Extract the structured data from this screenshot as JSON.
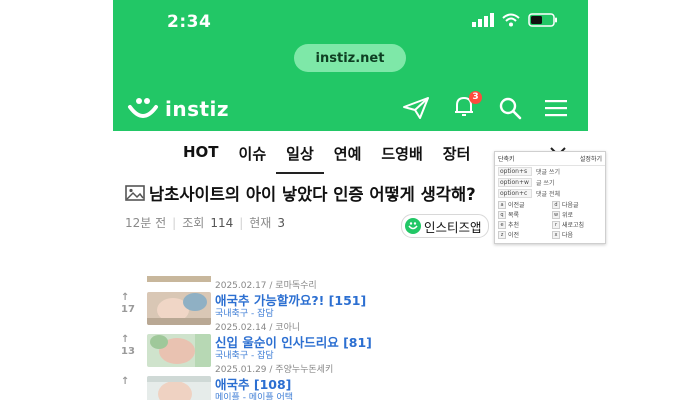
{
  "status_bar": {
    "time": "2:34"
  },
  "browser": {
    "url": "instiz.net"
  },
  "header": {
    "logo_text": "instiz",
    "notification_count": "3"
  },
  "tabs": [
    {
      "label": "HOT"
    },
    {
      "label": "이슈"
    },
    {
      "label": "일상"
    },
    {
      "label": "연예"
    },
    {
      "label": "드영배"
    },
    {
      "label": "장터"
    }
  ],
  "post": {
    "title": "남초사이트의 아이 낳았다 인증 어떻게 생각해?",
    "time_ago": "12분 전",
    "views_label": "조회",
    "views": "114",
    "current_label": "현재",
    "current": "3",
    "chip_label": "인스티즈앱"
  },
  "related": [
    {
      "date": "2025.02.17 / 로마독수리",
      "title": "애국추 가능할까요?!",
      "count": "[151]",
      "board": "국내축구 - 잡담",
      "edge": "↑\n17"
    },
    {
      "date": "2025.02.14 / 코아니",
      "title": "신입 울순이 인사드리요",
      "count": "[81]",
      "board": "국내축구 - 잡담",
      "edge": "↑\n13"
    },
    {
      "date": "2025.01.29 / 주양누누돈세키",
      "title": "애국추",
      "count": "[108]",
      "board": "메이플 - 메이플 어택",
      "edge": "↑"
    }
  ],
  "popup": {
    "header_left": "단축키",
    "header_right": "설정하기",
    "rows": [
      {
        "key": "option+s",
        "desc": "댓글 쓰기"
      },
      {
        "key": "option+w",
        "desc": "글 쓰기"
      },
      {
        "key": "option+c",
        "desc": "댓글 전체"
      }
    ],
    "grid": [
      {
        "key": "a",
        "desc": "이전글"
      },
      {
        "key": "d",
        "desc": "다음글"
      },
      {
        "key": "q",
        "desc": "목록"
      },
      {
        "key": "w",
        "desc": "위로"
      },
      {
        "key": "e",
        "desc": "추천"
      },
      {
        "key": "r",
        "desc": "새로고침"
      },
      {
        "key": "z",
        "desc": "이전"
      },
      {
        "key": "x",
        "desc": "다음"
      }
    ]
  },
  "colors": {
    "brand": "#22c766",
    "link": "#2c6fd1",
    "badge": "#ff4b3e"
  }
}
